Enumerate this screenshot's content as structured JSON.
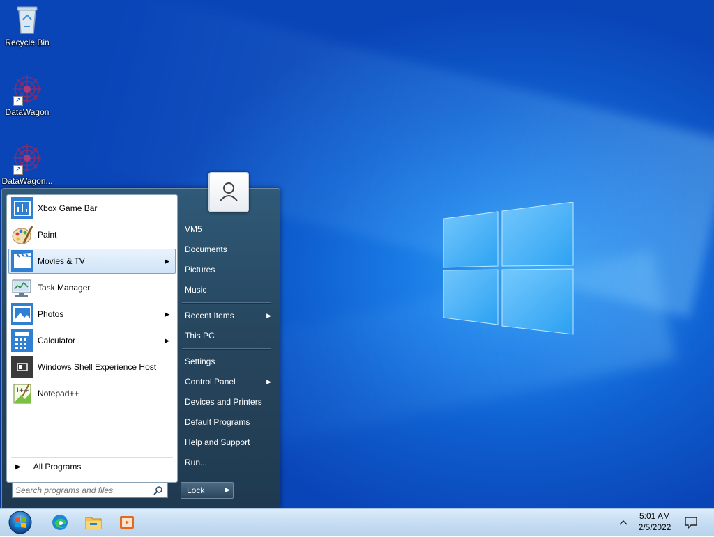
{
  "desktop": {
    "icons": [
      {
        "label": "Recycle Bin",
        "icon": "recycle-bin-icon"
      },
      {
        "label": "DataWagon",
        "icon": "datawagon-icon"
      },
      {
        "label": "DataWagon...",
        "icon": "datawagon-icon"
      }
    ]
  },
  "start_menu": {
    "programs": [
      {
        "label": "Xbox Game Bar",
        "icon": "xbox-game-bar-icon",
        "submenu": false
      },
      {
        "label": "Paint",
        "icon": "paint-icon",
        "submenu": false
      },
      {
        "label": "Movies & TV",
        "icon": "movies-tv-icon",
        "submenu": true,
        "highlighted": true
      },
      {
        "label": "Task Manager",
        "icon": "task-manager-icon",
        "submenu": false
      },
      {
        "label": "Photos",
        "icon": "photos-icon",
        "submenu": true
      },
      {
        "label": "Calculator",
        "icon": "calculator-icon",
        "submenu": true
      },
      {
        "label": "Windows Shell Experience Host",
        "icon": "shell-host-icon",
        "submenu": false
      },
      {
        "label": "Notepad++",
        "icon": "notepad-plus-plus-icon",
        "submenu": false
      }
    ],
    "all_programs": "All Programs",
    "search_placeholder": "Search programs and files",
    "right_links": [
      {
        "label": "VM5"
      },
      {
        "label": "Documents"
      },
      {
        "label": "Pictures"
      },
      {
        "label": "Music"
      },
      {
        "label": "Recent Items",
        "submenu": true
      },
      {
        "label": "This PC"
      },
      {
        "label": "Settings"
      },
      {
        "label": "Control Panel",
        "submenu": true
      },
      {
        "label": "Devices and Printers"
      },
      {
        "label": "Default Programs"
      },
      {
        "label": "Help and Support"
      },
      {
        "label": "Run..."
      }
    ],
    "lock_label": "Lock"
  },
  "taskbar": {
    "apps": [
      "edge-icon",
      "file-explorer-icon",
      "media-player-icon"
    ],
    "time": "5:01 AM",
    "date": "2/5/2022"
  },
  "colors": {
    "desktop_blue": "#0f5fd0",
    "menu_dark": "#27465e",
    "highlight": "#cfe4f8",
    "taskbar": "#c6ddf2"
  }
}
